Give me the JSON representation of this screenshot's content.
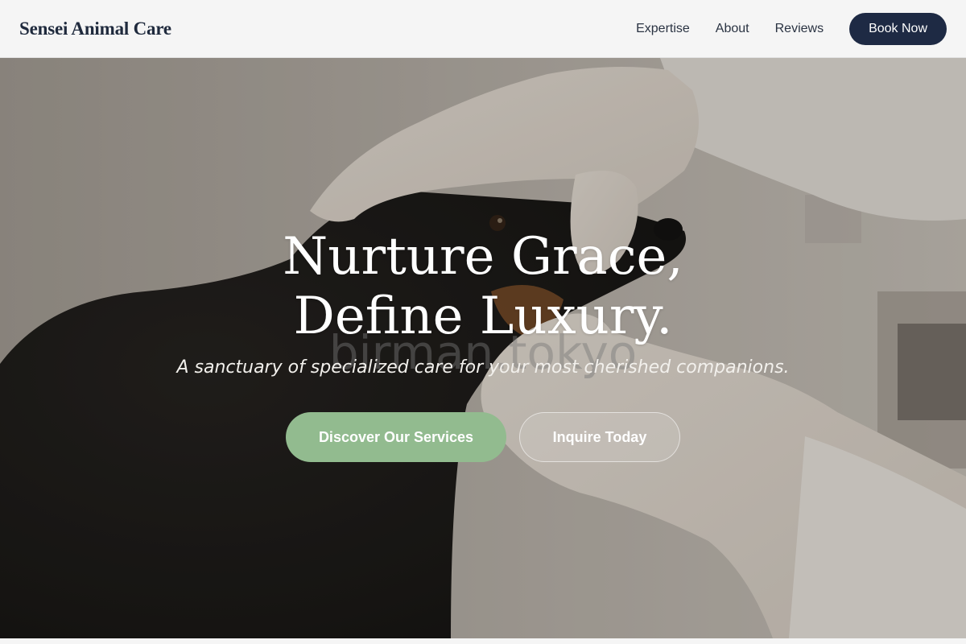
{
  "header": {
    "brand": "Sensei Animal Care",
    "nav": [
      "Expertise",
      "About",
      "Reviews"
    ],
    "cta": "Book Now"
  },
  "hero": {
    "title_line1": "Nurture Grace,",
    "title_line2": "Define Luxury.",
    "watermark": "birman.tokyo",
    "subtitle": "A sanctuary of specialized care for your most cherished companions.",
    "primary_cta": "Discover Our Services",
    "secondary_cta": "Inquire Today",
    "image_subject": "veterinarian-gloved-hands-examining-dachshund-photo"
  },
  "colors": {
    "nav_bg": "#f5f5f5",
    "brand_navy": "#1e2a44",
    "accent_green": "#92bb8f",
    "hero_text": "#ffffff"
  }
}
